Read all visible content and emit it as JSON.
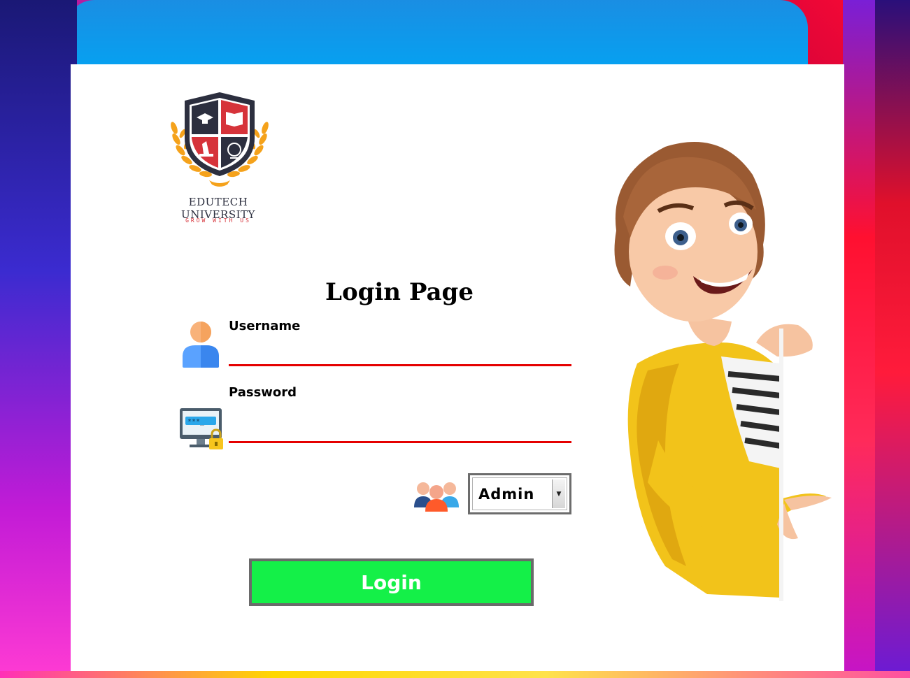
{
  "brand": {
    "name": "EDUTECH UNIVERSITY",
    "tagline": "GROW WITH US"
  },
  "login": {
    "title": "Login Page",
    "username_label": "Username",
    "username_value": "",
    "password_label": "Password",
    "password_value": "",
    "role_selected": "Admin",
    "submit_label": "Login"
  },
  "icons": {
    "user": "user-icon",
    "password": "password-monitor-icon",
    "role": "user-group-icon",
    "dropdown": "chevron-down-icon",
    "logo": "university-shield-logo",
    "mascot": "cartoon-girl-illustration"
  },
  "colors": {
    "underline": "#e50000",
    "button": "#14f048",
    "button_border": "#6a6a6a",
    "logo_red": "#d6333a",
    "logo_dark": "#2c2f3f"
  }
}
